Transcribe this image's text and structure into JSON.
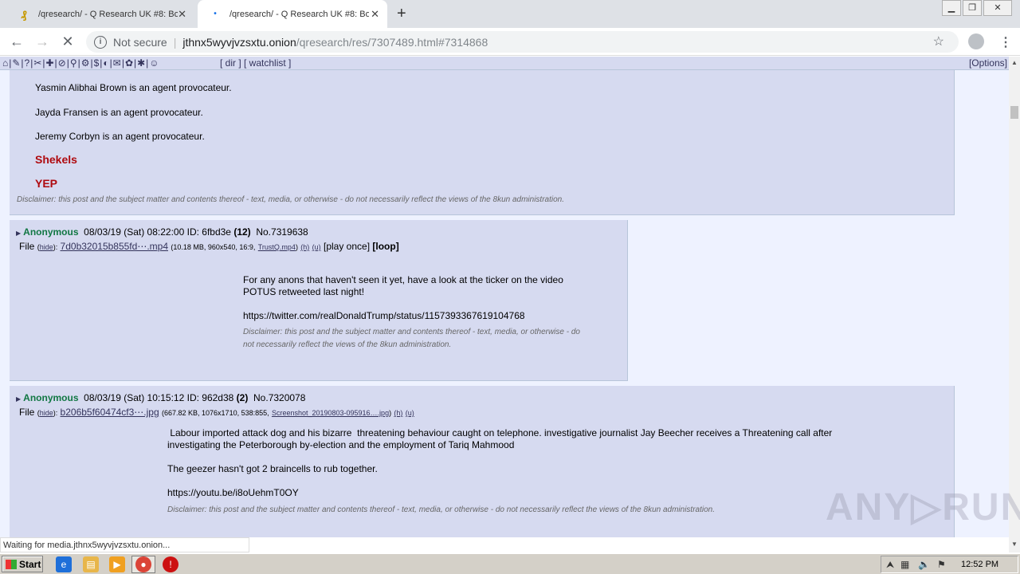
{
  "browser": {
    "tabs": [
      {
        "title": "/qresearch/ - Q Research UK #8: Bo",
        "active": false
      },
      {
        "title": "/qresearch/ - Q Research UK #8: Bo",
        "active": true
      }
    ],
    "security_label": "Not secure",
    "url_host": "jthnx5wyvjvzsxtu.onion",
    "url_path": "/qresearch/res/7307489.html#7314868",
    "status_text": "Waiting for media.jthnx5wyvjvzsxtu.onion..."
  },
  "boardbar": {
    "icons": "⌂|✎|?|✂|✚|⊘|⚲|⚙|$|◐|✉|✿|✱|☺",
    "links": "[ dir ] [ watchlist ]",
    "options": "[Options]"
  },
  "post1": {
    "lines": [
      "Yasmin Alibhai Brown is an agent provocateur.",
      "Jayda Fransen is an agent provocateur.",
      "Jeremy Corbyn is an agent provocateur."
    ],
    "red1": "Shekels",
    "red2": "YEP",
    "disclaimer": "Disclaimer: this post and the subject matter and contents thereof - text, media, or otherwise - do not necessarily reflect the views of the 8kun administration."
  },
  "post2": {
    "name": "Anonymous",
    "date": "08/03/19 (Sat) 08:22:00",
    "id_label": "ID: 6fbd3e",
    "id_count": "(12)",
    "number": "No.7319638",
    "file_label": "File",
    "hide": "hide",
    "filename": "7d0b32015b855fd⋯.mp4",
    "fileinfo": "(10.18 MB, 960x540, 16:9,",
    "orig_name": "TrustQ.mp4",
    "h": "(h)",
    "u": "(u)",
    "play_once": "[play once]",
    "loop": "[loop]",
    "text1": "For any anons that haven't seen it yet, have a look at the ticker on the video",
    "text2": "POTUS retweeted last night!",
    "link": "https://twitter.com/realDonaldTrump/status/1157393367619104768",
    "disclaimer1": "Disclaimer: this post and the subject matter and contents thereof - text, media, or otherwise - do",
    "disclaimer2": "not necessarily reflect the views of the 8kun administration."
  },
  "post3": {
    "name": "Anonymous",
    "date": "08/03/19 (Sat) 10:15:12",
    "id_label": "ID: 962d38",
    "id_count": "(2)",
    "number": "No.7320078",
    "file_label": "File",
    "hide": "hide",
    "filename": "b206b5f60474cf3⋯.jpg",
    "fileinfo": "(667.82 KB, 1076x1710, 538:855,",
    "orig_name": "Screenshot_20190803-095916….jpg",
    "h": "(h)",
    "u": "(u)",
    "text1": " Labour imported attack dog and his bizarre  threatening behaviour caught on telephone. investigative journalist Jay Beecher receives a Threatening call after",
    "text2": "investigating the Peterborough by-election and the employment of Tariq Mahmood",
    "text3": "The geezer hasn't got 2 braincells to rub together.",
    "link": "https://youtu.be/i8oUehmT0OY",
    "disclaimer": "Disclaimer: this post and the subject matter and contents thereof - text, media, or otherwise - do not necessarily reflect the views of the 8kun administration."
  },
  "watermark": "ANY▷RUN",
  "taskbar": {
    "start": "Start",
    "clock": "12:52 PM"
  }
}
